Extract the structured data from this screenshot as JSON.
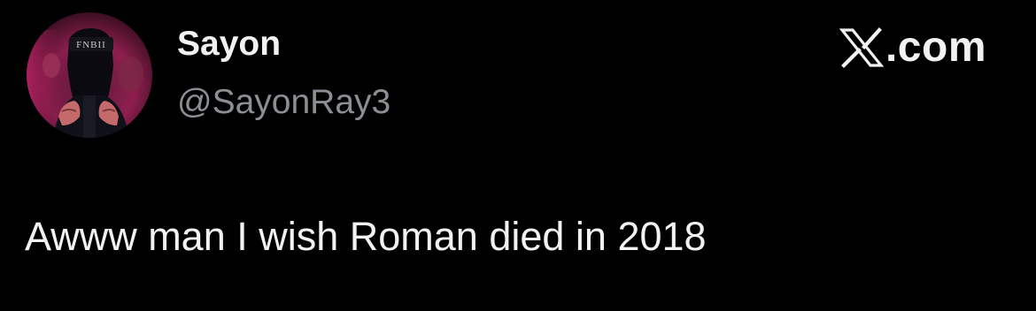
{
  "tweet": {
    "author_name": "Sayon",
    "author_handle": "@SayonRay3",
    "text": "Awww man I wish Roman died in 2018"
  },
  "brand": {
    "suffix": ".com",
    "icon": "x-logo-icon"
  },
  "avatar": {
    "icon": "profile-avatar",
    "cap_text": "FNBII"
  },
  "colors": {
    "background": "#000000",
    "name": "#f2f2f2",
    "handle": "#8b8f94",
    "body_text": "#f2f2f2",
    "avatar_glow": "#b2205a"
  }
}
